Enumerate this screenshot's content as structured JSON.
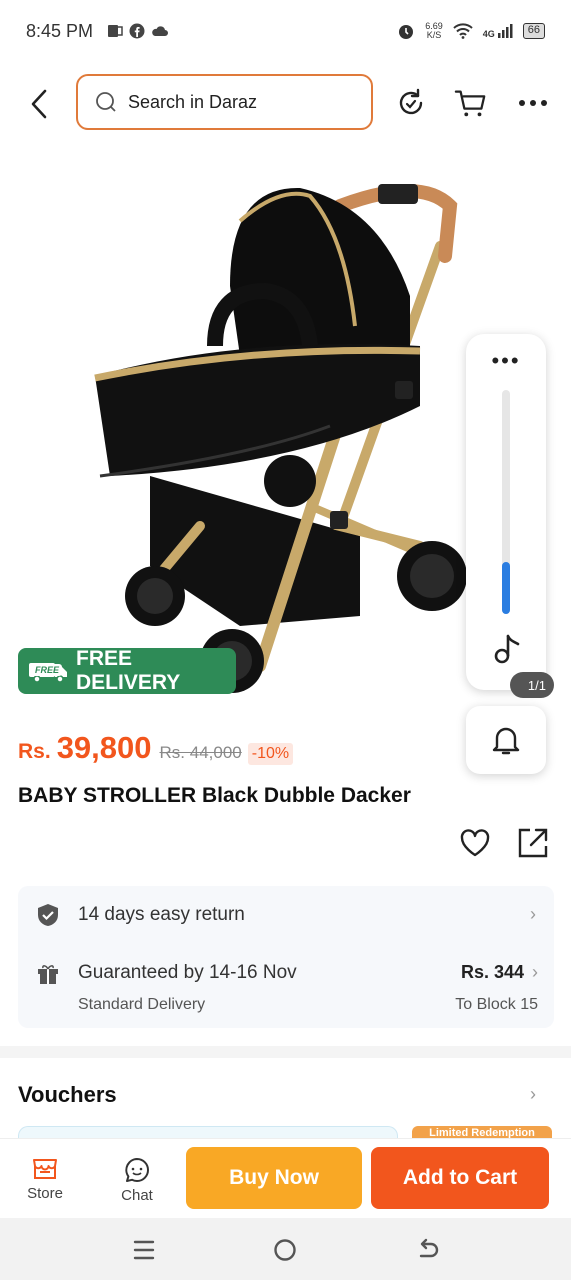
{
  "status_bar": {
    "time": "8:45 PM",
    "net_speed_value": "6.69",
    "net_speed_unit": "K/S",
    "network": "4G",
    "battery": "66"
  },
  "top_nav": {
    "search_placeholder": "Search in Daraz"
  },
  "promo": {
    "free_tag": "FREE",
    "free_delivery_label": "FREE DELIVERY"
  },
  "media_panel": {
    "more_dots": "•••",
    "volume_level": 0.23,
    "page_indicator": "1/1"
  },
  "product": {
    "currency": "Rs.",
    "price": "39,800",
    "original_price": "Rs. 44,000",
    "discount": "-10%",
    "title": "BABY STROLLER Black Dubble Dacker"
  },
  "info": {
    "return_text": "14 days easy return",
    "delivery_text": "Guaranteed by 14-16 Nov",
    "delivery_type": "Standard Delivery",
    "delivery_fee": "Rs. 344",
    "delivery_location": "To Block 15"
  },
  "vouchers": {
    "title": "Vouchers",
    "badge": "Limited Redemption"
  },
  "bottom_bar": {
    "store_label": "Store",
    "chat_label": "Chat",
    "buy_now_label": "Buy Now",
    "add_to_cart_label": "Add to Cart"
  },
  "colors": {
    "brand_orange": "#f2561d",
    "buy_yellow": "#f9a825",
    "delivery_green": "#2e8b57",
    "slider_blue": "#2a7de1"
  }
}
